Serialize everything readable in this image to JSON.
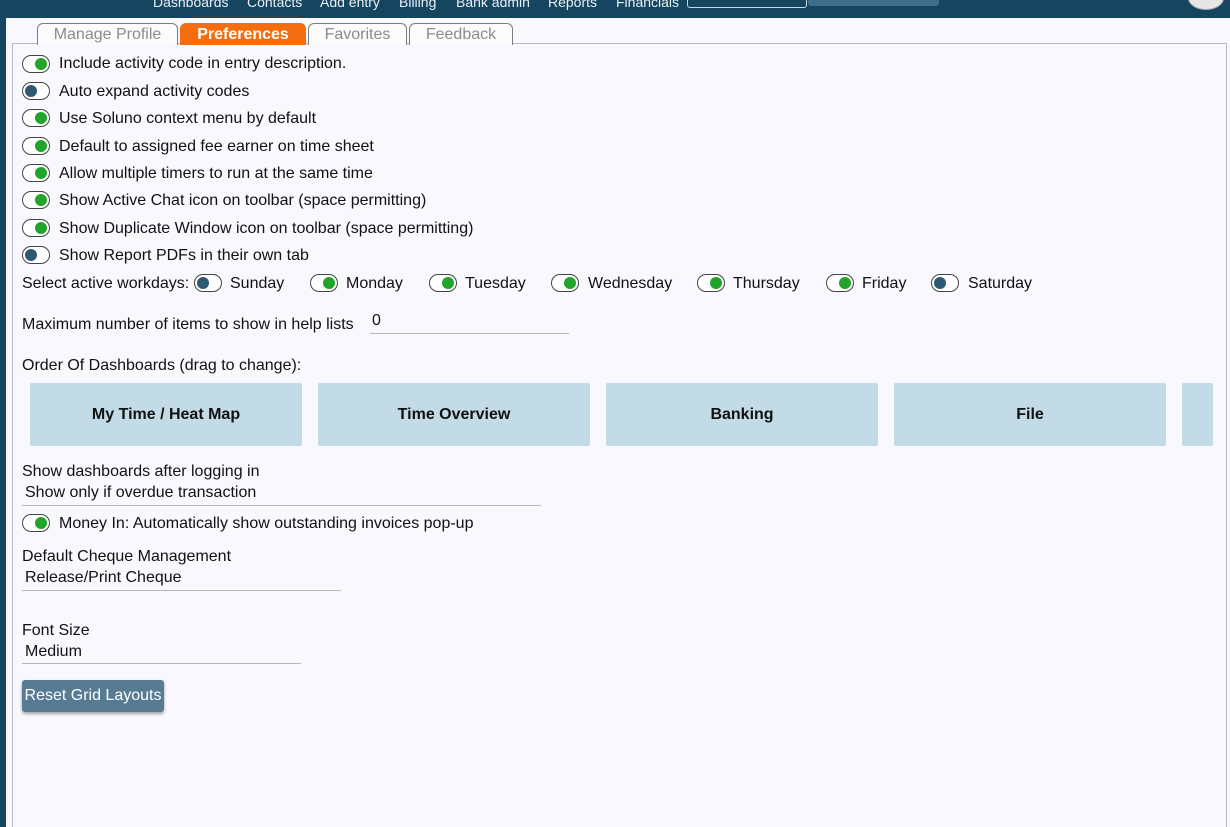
{
  "topnav": {
    "items": [
      "Dashboards",
      "Contacts",
      "Add entry",
      "Billing",
      "Bank admin",
      "Reports",
      "Financials"
    ]
  },
  "tabs": [
    {
      "label": "Manage Profile",
      "active": false
    },
    {
      "label": "Preferences",
      "active": true
    },
    {
      "label": "Favorites",
      "active": false
    },
    {
      "label": "Feedback",
      "active": false
    }
  ],
  "preferences": [
    {
      "label": "Include activity code in entry description.",
      "on": true
    },
    {
      "label": "Auto expand activity codes",
      "on": false
    },
    {
      "label": "Use Soluno context menu by default",
      "on": true
    },
    {
      "label": "Default to assigned fee earner on time sheet",
      "on": true
    },
    {
      "label": "Allow multiple timers to run at the same time",
      "on": true
    },
    {
      "label": "Show Active Chat icon on toolbar (space permitting)",
      "on": true
    },
    {
      "label": "Show Duplicate Window icon on toolbar (space permitting)",
      "on": true
    },
    {
      "label": "Show Report PDFs in their own tab",
      "on": false
    }
  ],
  "workdays": {
    "label": "Select active workdays:",
    "days": [
      {
        "label": "Sunday",
        "on": false
      },
      {
        "label": "Monday",
        "on": true
      },
      {
        "label": "Tuesday",
        "on": true
      },
      {
        "label": "Wednesday",
        "on": true
      },
      {
        "label": "Thursday",
        "on": true
      },
      {
        "label": "Friday",
        "on": true
      },
      {
        "label": "Saturday",
        "on": false
      }
    ]
  },
  "max_items": {
    "label": "Maximum number of items to show in help lists",
    "value": "0"
  },
  "dashboards": {
    "label": "Order Of Dashboards (drag to change):",
    "items": [
      "My Time / Heat Map",
      "Time Overview",
      "Banking",
      "File"
    ]
  },
  "show_dashboards": {
    "label": "Show dashboards after logging in",
    "value": "Show only if overdue transaction"
  },
  "money_in": {
    "label": "Money In: Automatically show outstanding invoices pop-up",
    "on": true
  },
  "cheque": {
    "label": "Default Cheque Management",
    "value": "Release/Print Cheque"
  },
  "font_size": {
    "label": "Font Size",
    "value": "Medium"
  },
  "reset_button": "Reset Grid Layouts",
  "colors": {
    "header": "#16455f",
    "active_tab": "#f46d10",
    "toggle_on": "#22a329",
    "toggle_off": "#2f5872",
    "dashboard_card": "#c2dbe6",
    "button": "#567b93"
  }
}
